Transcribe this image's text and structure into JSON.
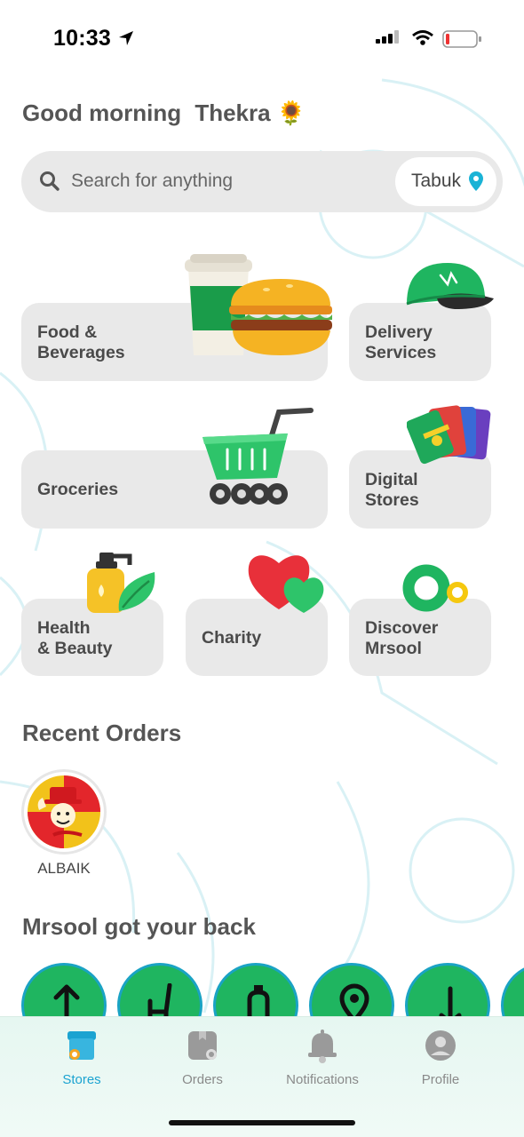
{
  "status_bar": {
    "time": "10:33"
  },
  "greeting": {
    "text": "Good morning",
    "name": "Thekra",
    "emoji": "🌻"
  },
  "search": {
    "placeholder": "Search for anything",
    "city": "Tabuk"
  },
  "categories": [
    {
      "line1": "Food &",
      "line2": "Beverages",
      "icon": "burger-coffee-icon"
    },
    {
      "line1": "Delivery",
      "line2": "Services",
      "icon": "cap-icon"
    },
    {
      "line1": "Groceries",
      "line2": "",
      "icon": "cart-icon"
    },
    {
      "line1": "Digital",
      "line2": "Stores",
      "icon": "gift-cards-icon"
    },
    {
      "line1": "Health",
      "line2": "& Beauty",
      "icon": "soap-bottle-icon"
    },
    {
      "line1": "Charity",
      "line2": "",
      "icon": "hearts-icon"
    },
    {
      "line1": "Discover",
      "line2": "Mrsool",
      "icon": "mrsool-logo-icon"
    }
  ],
  "recent_orders": {
    "title": "Recent Orders",
    "items": [
      {
        "name": "ALBAIK"
      }
    ]
  },
  "help": {
    "title": "Mrsool got your back",
    "icons": [
      "arrow-up-icon",
      "chair-icon",
      "bottle-icon",
      "location-pin-icon",
      "arrow-down-icon",
      "more-icon"
    ]
  },
  "tab_bar": {
    "tabs": [
      {
        "label": "Stores",
        "icon": "store-icon",
        "active": true
      },
      {
        "label": "Orders",
        "icon": "orders-icon",
        "active": false
      },
      {
        "label": "Notifications",
        "icon": "bell-icon",
        "active": false
      },
      {
        "label": "Profile",
        "icon": "profile-icon",
        "active": false
      }
    ]
  },
  "colors": {
    "accent": "#1ba3d1",
    "green": "#1fb560",
    "card_bg": "#e9e9e9",
    "pin": "#1ab3d6"
  }
}
